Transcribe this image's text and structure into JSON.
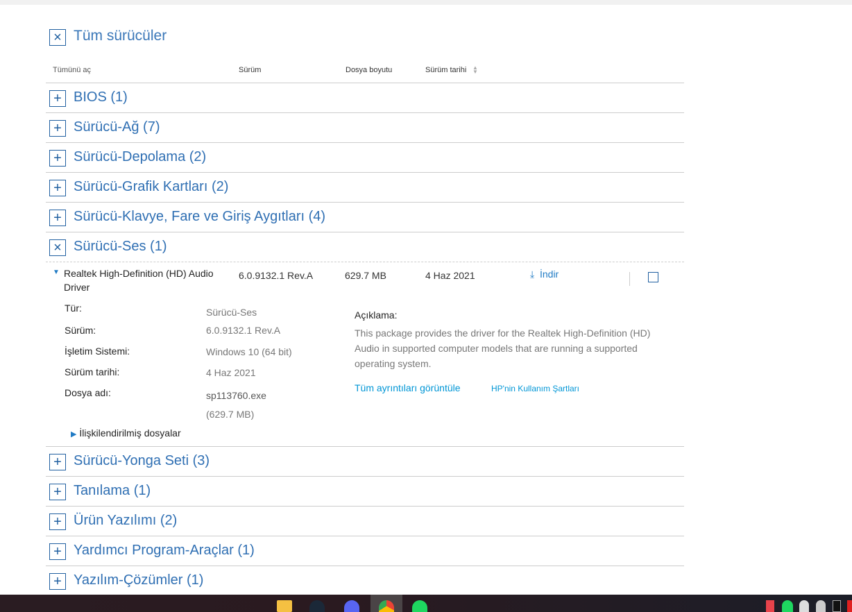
{
  "header": {
    "title": "Tüm sürücüler",
    "collapse_icon": "close-icon"
  },
  "columns": {
    "expand_all": "Tümünü aç",
    "version": "Sürüm",
    "file_size": "Dosya boyutu",
    "release_date": "Sürüm tarihi"
  },
  "categories_before": [
    {
      "label": "BIOS (1)"
    },
    {
      "label": "Sürücü-Ağ (7)"
    },
    {
      "label": "Sürücü-Depolama (2)"
    },
    {
      "label": "Sürücü-Grafik Kartları (2)"
    },
    {
      "label": "Sürücü-Klavye, Fare ve Giriş Aygıtları (4)"
    }
  ],
  "expanded_category": {
    "label": "Sürücü-Ses (1)"
  },
  "driver": {
    "name": "Realtek High-Definition (HD) Audio Driver",
    "version": "6.0.9132.1 Rev.A",
    "size": "629.7 MB",
    "date": "4 Haz 2021",
    "download": "İndir",
    "details": [
      {
        "k": "Tür:",
        "v": "Sürücü-Ses"
      },
      {
        "k": "Sürüm:",
        "v": "6.0.9132.1 Rev.A"
      },
      {
        "k": "İşletim Sistemi:",
        "v": "Windows 10 (64 bit)"
      },
      {
        "k": "Sürüm tarihi:",
        "v": "4 Haz 2021"
      },
      {
        "k": "Dosya adı:",
        "v": "sp113760.exe"
      }
    ],
    "file_size_paren": "(629.7 MB)",
    "desc_title": "Açıklama:",
    "description": "This package provides the driver for the Realtek High-Definition (HD) Audio in supported computer models that are running a supported operating system.",
    "link_details": "Tüm ayrıntıları görüntüle",
    "link_terms": "HP'nin Kullanım Şartları",
    "related": "İlişkilendirilmiş dosyalar"
  },
  "categories_after": [
    {
      "label": "Sürücü-Yonga Seti (3)"
    },
    {
      "label": "Tanılama (1)"
    },
    {
      "label": "Ürün Yazılımı (2)"
    },
    {
      "label": "Yardımcı Program-Araçlar (1)"
    },
    {
      "label": "Yazılım-Çözümler (1)"
    }
  ],
  "taskbar": {
    "apps": [
      "file-explorer",
      "steam",
      "discord",
      "chrome",
      "spotify"
    ],
    "tray": [
      "valorant",
      "spotify",
      "discord",
      "app",
      "epic-games"
    ]
  }
}
